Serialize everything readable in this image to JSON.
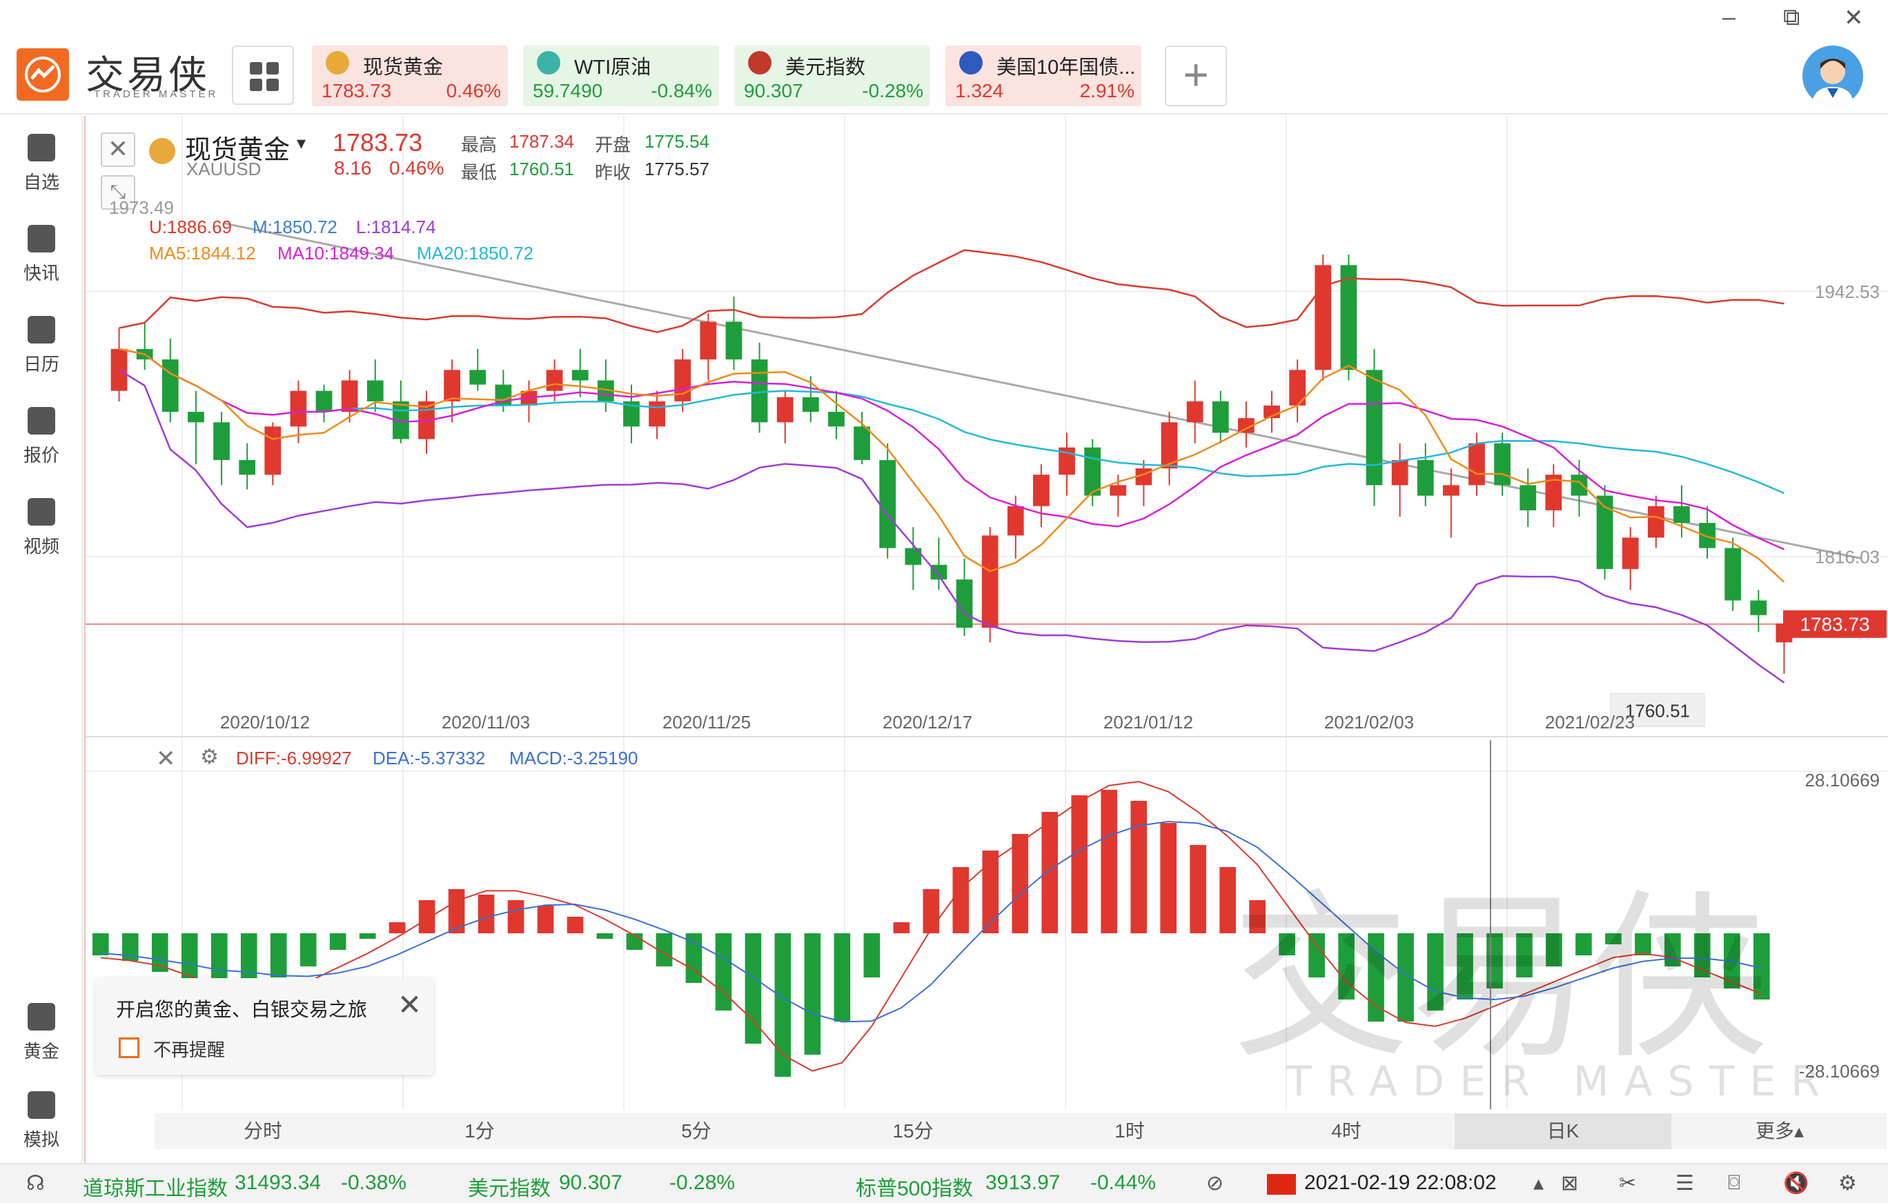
{
  "app": {
    "logo_text": "交易侠",
    "logo_sub": "TRADER MASTER"
  },
  "window": {
    "minimize": "–",
    "restore": "⧉",
    "close": "✕"
  },
  "watchlist": [
    {
      "name": "现货黄金",
      "price": "1783.73",
      "pct": "0.46%",
      "dir": "up",
      "bg": "#fbe3df",
      "icon": "gold-bar-icon",
      "icon_color": "#e8a93a"
    },
    {
      "name": "WTI原油",
      "price": "59.7490",
      "pct": "-0.84%",
      "dir": "dn",
      "bg": "#e6f5e6",
      "icon": "oil-drop-icon",
      "icon_color": "#3bb3a6"
    },
    {
      "name": "美元指数",
      "price": "90.307",
      "pct": "-0.28%",
      "dir": "dn",
      "bg": "#e6f5e6",
      "icon": "us-flag-icon",
      "icon_color": "#c0392b"
    },
    {
      "name": "美国10年国债...",
      "price": "1.324",
      "pct": "2.91%",
      "dir": "up",
      "bg": "#fbe3df",
      "icon": "bond-chart-icon",
      "icon_color": "#2e5bbd"
    }
  ],
  "add_label": "+",
  "sidebar": [
    {
      "label": "自选",
      "icon": "bookmark-icon"
    },
    {
      "label": "快讯",
      "icon": "news-icon"
    },
    {
      "label": "日历",
      "icon": "calendar-icon"
    },
    {
      "label": "报价",
      "icon": "quote-chart-icon"
    },
    {
      "label": "视频",
      "icon": "video-icon"
    },
    {
      "label": "黄金",
      "icon": "sge-gold-icon"
    },
    {
      "label": "模拟",
      "icon": "simulate-icon"
    }
  ],
  "symbol": {
    "name": "现货黄金",
    "caret": "▾",
    "code": "XAUUSD",
    "price": "1783.73",
    "change": "8.16",
    "pct": "0.46%",
    "high_label": "最高",
    "high": "1787.34",
    "open_label": "开盘",
    "open": "1775.54",
    "low_label": "最低",
    "low": "1760.51",
    "prev_label": "昨收",
    "prev": "1775.57"
  },
  "indicators": {
    "boll": {
      "u": "U:1886.69",
      "m": "M:1850.72",
      "l": "L:1814.74"
    },
    "ma": {
      "ma5": "MA5:1844.12",
      "ma10": "MA10:1849.34",
      "ma20": "MA20:1850.72"
    },
    "macd": {
      "diff": "DIFF:-6.99927",
      "dea": "DEA:-5.37332",
      "macd": "MACD:-3.25190"
    },
    "colors": {
      "u": "#d93a2b",
      "m": "#3a7fd6",
      "l": "#a03ad9",
      "ma5": "#f08a18",
      "ma10": "#d81ed8",
      "ma20": "#22b8d8",
      "diff": "#d93a2b",
      "dea": "#3a6fd6",
      "macd": "#3a6fd6"
    }
  },
  "price_labels": {
    "top_left": "1973.49",
    "right1": "1942.53",
    "right2": "1816.03",
    "current": "1783.73",
    "low_callout": "1760.51"
  },
  "macd_labels": {
    "top": "28.10669",
    "bottom": "-28.10669"
  },
  "dates": [
    "2020/10/12",
    "2020/11/03",
    "2020/11/25",
    "2020/12/17",
    "2021/01/12",
    "2021/02/03",
    "2021/02/23"
  ],
  "timeframes": [
    {
      "label": "分时",
      "active": false
    },
    {
      "label": "1分",
      "active": false
    },
    {
      "label": "5分",
      "active": false
    },
    {
      "label": "15分",
      "active": false
    },
    {
      "label": "1时",
      "active": false
    },
    {
      "label": "4时",
      "active": false
    },
    {
      "label": "日K",
      "active": true
    },
    {
      "label": "更多▴",
      "active": false
    }
  ],
  "tooltip": {
    "text": "开启您的黄金、白银交易之旅",
    "checkbox_label": "不再提醒",
    "close": "✕"
  },
  "watermark": {
    "text": "交易侠",
    "sub": "TRADER MASTER"
  },
  "status": {
    "items": [
      {
        "name": "道琼斯工业指数",
        "value": "31493.34",
        "pct": "-0.38%"
      },
      {
        "name": "美元指数",
        "value": "90.307",
        "pct": "-0.28%"
      },
      {
        "name": "标普500指数",
        "value": "3913.97",
        "pct": "-0.44%"
      }
    ],
    "datetime": "2021-02-19 22:08:02"
  },
  "chart_data": {
    "type": "candlestick",
    "title": "现货黄金 XAUUSD",
    "ylim": [
      1730,
      1990
    ],
    "x": [
      "2020/10/12",
      "2020/11/03",
      "2020/11/25",
      "2020/12/17",
      "2021/01/12",
      "2021/02/03",
      "2021/02/23"
    ],
    "ohlc": [
      [
        1895,
        1925,
        1890,
        1915
      ],
      [
        1915,
        1928,
        1905,
        1910
      ],
      [
        1910,
        1920,
        1880,
        1885
      ],
      [
        1885,
        1895,
        1860,
        1880
      ],
      [
        1880,
        1885,
        1850,
        1862
      ],
      [
        1862,
        1870,
        1848,
        1855
      ],
      [
        1855,
        1880,
        1850,
        1878
      ],
      [
        1878,
        1900,
        1870,
        1895
      ],
      [
        1895,
        1898,
        1880,
        1885
      ],
      [
        1885,
        1905,
        1880,
        1900
      ],
      [
        1900,
        1910,
        1885,
        1890
      ],
      [
        1890,
        1900,
        1870,
        1872
      ],
      [
        1872,
        1895,
        1865,
        1890
      ],
      [
        1890,
        1910,
        1880,
        1905
      ],
      [
        1905,
        1915,
        1895,
        1898
      ],
      [
        1898,
        1905,
        1885,
        1888
      ],
      [
        1888,
        1900,
        1880,
        1895
      ],
      [
        1895,
        1910,
        1890,
        1905
      ],
      [
        1905,
        1915,
        1892,
        1900
      ],
      [
        1900,
        1910,
        1885,
        1890
      ],
      [
        1890,
        1898,
        1870,
        1878
      ],
      [
        1878,
        1895,
        1872,
        1890
      ],
      [
        1890,
        1915,
        1885,
        1910
      ],
      [
        1910,
        1932,
        1900,
        1928
      ],
      [
        1928,
        1940,
        1905,
        1910
      ],
      [
        1910,
        1918,
        1875,
        1880
      ],
      [
        1880,
        1895,
        1870,
        1892
      ],
      [
        1892,
        1902,
        1880,
        1885
      ],
      [
        1885,
        1895,
        1872,
        1878
      ],
      [
        1878,
        1885,
        1860,
        1862
      ],
      [
        1862,
        1870,
        1815,
        1820
      ],
      [
        1820,
        1830,
        1800,
        1812
      ],
      [
        1812,
        1825,
        1800,
        1805
      ],
      [
        1805,
        1815,
        1778,
        1782
      ],
      [
        1782,
        1830,
        1775,
        1826
      ],
      [
        1826,
        1845,
        1815,
        1840
      ],
      [
        1840,
        1860,
        1830,
        1855
      ],
      [
        1855,
        1875,
        1845,
        1868
      ],
      [
        1868,
        1872,
        1840,
        1845
      ],
      [
        1845,
        1855,
        1835,
        1850
      ],
      [
        1850,
        1862,
        1840,
        1858
      ],
      [
        1858,
        1885,
        1850,
        1880
      ],
      [
        1880,
        1900,
        1870,
        1890
      ],
      [
        1890,
        1895,
        1870,
        1875
      ],
      [
        1875,
        1890,
        1868,
        1882
      ],
      [
        1882,
        1895,
        1875,
        1888
      ],
      [
        1888,
        1910,
        1880,
        1905
      ],
      [
        1905,
        1960,
        1900,
        1955
      ],
      [
        1955,
        1960,
        1900,
        1905
      ],
      [
        1905,
        1915,
        1840,
        1850
      ],
      [
        1850,
        1870,
        1835,
        1862
      ],
      [
        1862,
        1870,
        1840,
        1845
      ],
      [
        1845,
        1858,
        1825,
        1850
      ],
      [
        1850,
        1875,
        1845,
        1870
      ],
      [
        1870,
        1875,
        1845,
        1850
      ],
      [
        1850,
        1858,
        1830,
        1838
      ],
      [
        1838,
        1860,
        1830,
        1855
      ],
      [
        1855,
        1862,
        1835,
        1845
      ],
      [
        1845,
        1850,
        1805,
        1810
      ],
      [
        1810,
        1830,
        1800,
        1825
      ],
      [
        1825,
        1845,
        1820,
        1840
      ],
      [
        1840,
        1850,
        1825,
        1832
      ],
      [
        1832,
        1840,
        1815,
        1820
      ],
      [
        1820,
        1825,
        1790,
        1795
      ],
      [
        1795,
        1800,
        1780,
        1788
      ],
      [
        1775,
        1787,
        1760,
        1784
      ]
    ],
    "macd_hist_note": "sampled bars, positive red / negative green",
    "macd_hist": [
      -4,
      -5,
      -7,
      -9,
      -12,
      -10,
      -8,
      -6,
      -3,
      -1,
      2,
      6,
      8,
      7,
      6,
      5,
      3,
      -1,
      -3,
      -6,
      -9,
      -14,
      -20,
      -26,
      -22,
      -16,
      -8,
      2,
      8,
      12,
      15,
      18,
      22,
      25,
      26,
      24,
      20,
      16,
      12,
      6,
      -4,
      -8,
      -12,
      -16,
      -16,
      -14,
      -12,
      -10,
      -8,
      -6,
      -4,
      -2,
      -4,
      -6,
      -8,
      -10,
      -12
    ]
  }
}
